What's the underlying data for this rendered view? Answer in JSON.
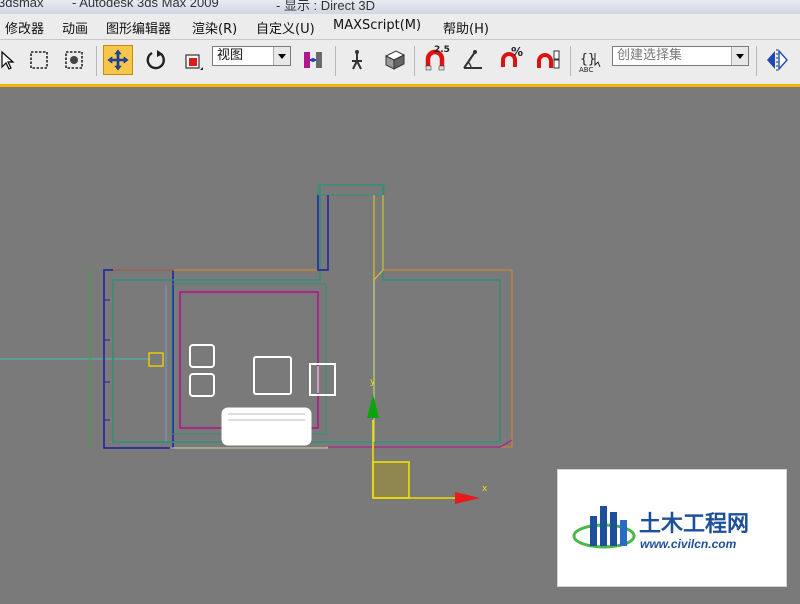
{
  "window": {
    "app_name": "3dsmax",
    "title": "- Autodesk 3ds Max  2009",
    "display_mode": "- 显示 : Direct 3D"
  },
  "menu": {
    "items": [
      {
        "label": "修改器"
      },
      {
        "label": "动画"
      },
      {
        "label": "图形编辑器"
      },
      {
        "label": "渲染(R)"
      },
      {
        "label": "自定义(U)"
      },
      {
        "label": "MAXScript(M)"
      },
      {
        "label": "帮助(H)"
      }
    ]
  },
  "toolbar": {
    "snap_angle_label": "2.5",
    "percent_snap_label": "%",
    "reference_coord": "视图",
    "named_selection_placeholder": "创建选择集",
    "abc_label": "ABC"
  },
  "viewport": {
    "axis_x_label": "x",
    "axis_y_label": "y",
    "colors": {
      "background": "#7a7a7a",
      "wall_green": "#2f8f7a",
      "outline_orange": "#d8852e",
      "room_purple": "#b0148f",
      "wall_blue": "#1b1ea0",
      "axis_y": "#0aa50a",
      "axis_x": "#e81b1b",
      "gizmo_yellow": "#f0e000"
    }
  },
  "watermark": {
    "site_name": "土木工程网",
    "url": "www.civilcn.com",
    "colors": {
      "primary": "#1d4f9a",
      "accent": "#48b848"
    }
  }
}
